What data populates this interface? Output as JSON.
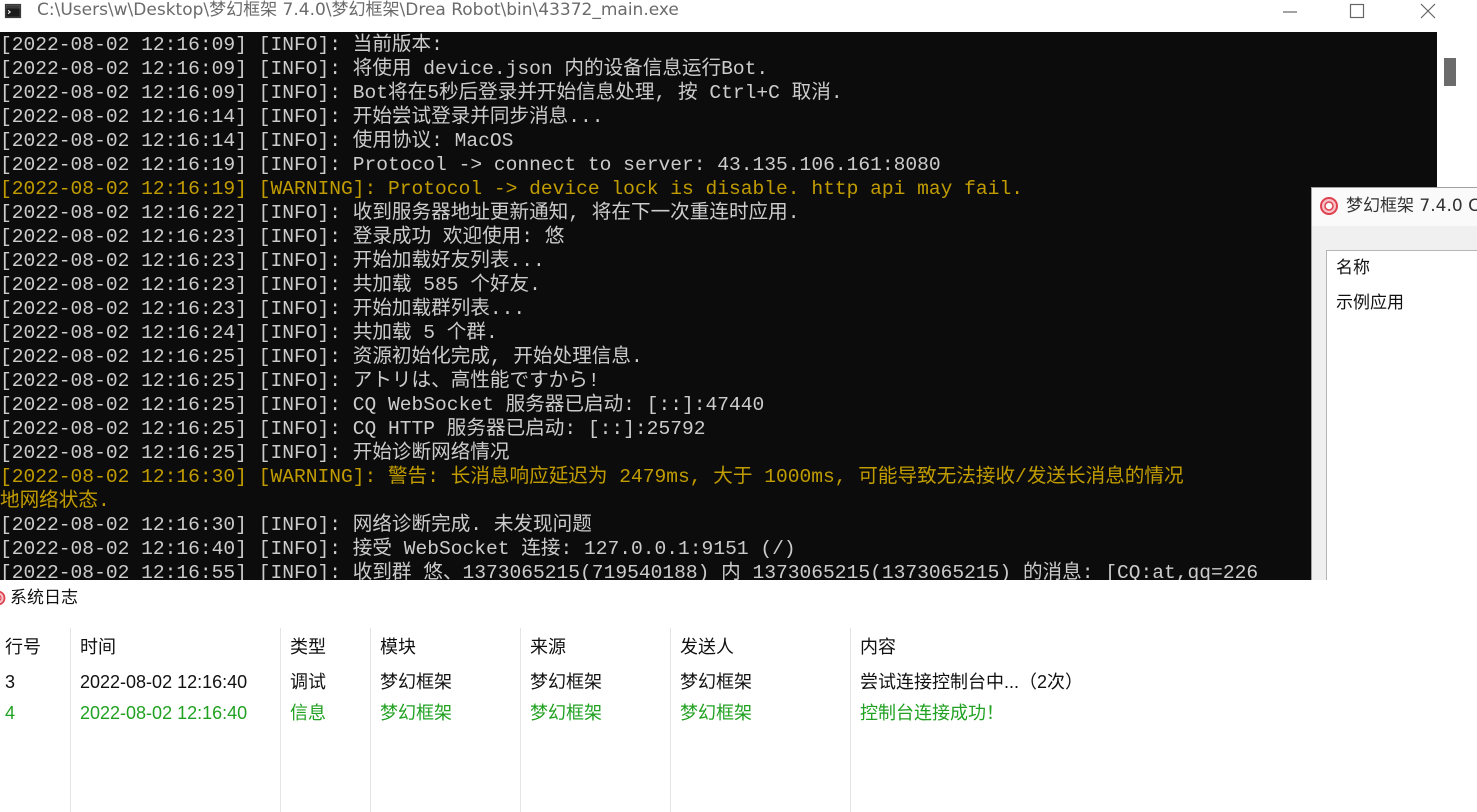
{
  "colors": {
    "console_bg": "#0c0c0c",
    "console_info": "#cccccc",
    "console_warning": "#c19c00",
    "log_text": "#111111",
    "log_info": "#21a121",
    "icon_red": "#e0414f"
  },
  "console": {
    "title": "C:\\Users\\w\\Desktop\\梦幻框架 7.4.0\\梦幻框架\\Drea Robot\\bin\\43372_main.exe",
    "icons": {
      "app": "console-app-icon",
      "minimize": "minimize-icon",
      "maximize": "maximize-icon",
      "close": "close-icon"
    },
    "lines": [
      "[2022-08-02 12:16:09] [INFO]: 当前版本:",
      "[2022-08-02 12:16:09] [INFO]: 将使用 device.json 内的设备信息运行Bot.",
      "[2022-08-02 12:16:09] [INFO]: Bot将在5秒后登录并开始信息处理, 按 Ctrl+C 取消.",
      "[2022-08-02 12:16:14] [INFO]: 开始尝试登录并同步消息...",
      "[2022-08-02 12:16:14] [INFO]: 使用协议: MacOS",
      "[2022-08-02 12:16:19] [INFO]: Protocol -> connect to server: 43.135.106.161:8080",
      "[2022-08-02 12:16:19] [WARNING]: Protocol -> device lock is disable. http api may fail.",
      "[2022-08-02 12:16:22] [INFO]: 收到服务器地址更新通知, 将在下一次重连时应用.",
      "[2022-08-02 12:16:23] [INFO]: 登录成功 欢迎使用: 悠",
      "[2022-08-02 12:16:23] [INFO]: 开始加载好友列表...",
      "[2022-08-02 12:16:23] [INFO]: 共加载 585 个好友.",
      "[2022-08-02 12:16:23] [INFO]: 开始加载群列表...",
      "[2022-08-02 12:16:24] [INFO]: 共加载 5 个群.",
      "[2022-08-02 12:16:25] [INFO]: 资源初始化完成, 开始处理信息.",
      "[2022-08-02 12:16:25] [INFO]: アトリは、高性能ですから!",
      "[2022-08-02 12:16:25] [INFO]: CQ WebSocket 服务器已启动: [::]:47440",
      "[2022-08-02 12:16:25] [INFO]: CQ HTTP 服务器已启动: [::]:25792",
      "[2022-08-02 12:16:25] [INFO]: 开始诊断网络情况",
      "[2022-08-02 12:16:30] [WARNING]: 警告: 长消息响应延迟为 2479ms, 大于 1000ms, 可能导致无法接收/发送长消息的情况",
      "地网络状态.",
      "[2022-08-02 12:16:30] [INFO]: 网络诊断完成. 未发现问题",
      "[2022-08-02 12:16:40] [INFO]: 接受 WebSocket 连接: 127.0.0.1:9151 (/)",
      "[2022-08-02 12:16:55] [INFO]: 收到群 悠、1373065215(719540188) 内 1373065215(1373065215) 的消息: [CQ:at,qq=226"
    ]
  },
  "plugin_window": {
    "title": "梦幻框架 7.4.0 C",
    "icon": "dream-frame-logo-icon",
    "column_header": "名称",
    "items": [
      "示例应用"
    ]
  },
  "log_panel": {
    "title": "系统日志",
    "icon": "dream-frame-logo-icon",
    "columns": [
      "行号",
      "时间",
      "类型",
      "模块",
      "来源",
      "发送人",
      "内容"
    ],
    "rows": [
      {
        "cells": [
          "3",
          "2022-08-02 12:16:40",
          "调试",
          "梦幻框架",
          "梦幻框架",
          "梦幻框架",
          "尝试连接控制台中...（2次）"
        ]
      },
      {
        "cells": [
          "4",
          "2022-08-02 12:16:40",
          "信息",
          "梦幻框架",
          "梦幻框架",
          "梦幻框架",
          "控制台连接成功！"
        ]
      }
    ]
  }
}
